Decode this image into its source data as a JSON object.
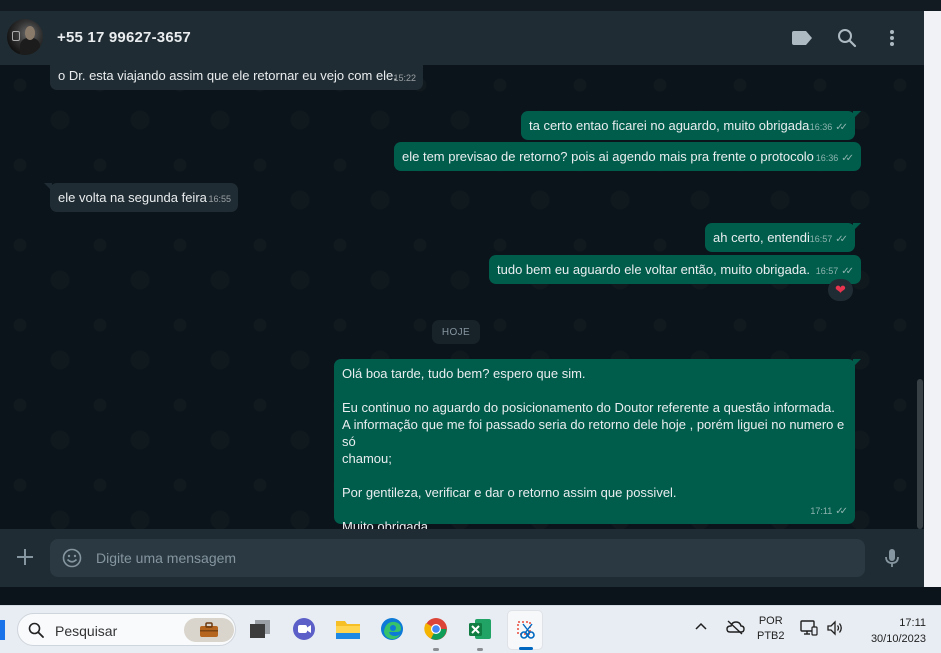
{
  "header": {
    "contact_name": "+55 17 99627-3657",
    "icons": [
      "label-icon",
      "search-icon",
      "menu-kebab-icon"
    ]
  },
  "messages": [
    {
      "dir": "in",
      "text": "o Dr. esta viajando assim que ele retornar eu vejo com ele.",
      "time": "15:22"
    },
    {
      "dir": "out",
      "text": "ta certo entao ficarei no aguardo, muito obrigada",
      "time": "16:36"
    },
    {
      "dir": "out",
      "text": "ele tem previsao de retorno? pois ai agendo mais pra frente o protocolo",
      "time": "16:36"
    },
    {
      "dir": "in",
      "text": "ele volta na segunda feira",
      "time": "16:55"
    },
    {
      "dir": "out",
      "text": "ah certo, entendi",
      "time": "16:57"
    },
    {
      "dir": "out",
      "text": "tudo bem eu aguardo ele voltar então, muito obrigada.",
      "time": "16:57",
      "reaction": "❤"
    },
    {
      "dir": "out",
      "time": "17:11",
      "lines": [
        "Olá boa tarde, tudo bem? espero que sim.",
        "",
        "Eu continuo no aguardo do posicionamento do Doutor referente a questão informada.",
        "A informação que me foi passado seria do retorno dele hoje , porém liguei no numero e só",
        "chamou;",
        "",
        "Por gentileza, verificar e dar o retorno assim que possivel.",
        "",
        "Muito obrigada"
      ]
    }
  ],
  "day_divider": "HOJE",
  "composer": {
    "placeholder": "Digite uma mensagem"
  },
  "taskbar": {
    "search_placeholder": "Pesquisar",
    "lang_top": "POR",
    "lang_bottom": "PTB2",
    "time": "17:11",
    "date": "30/10/2023"
  },
  "colors": {
    "outgoing": "#005c4b",
    "incoming": "#202c33",
    "background": "#0b141a",
    "header": "#202c33",
    "reaction_heart": "#e8344e"
  }
}
